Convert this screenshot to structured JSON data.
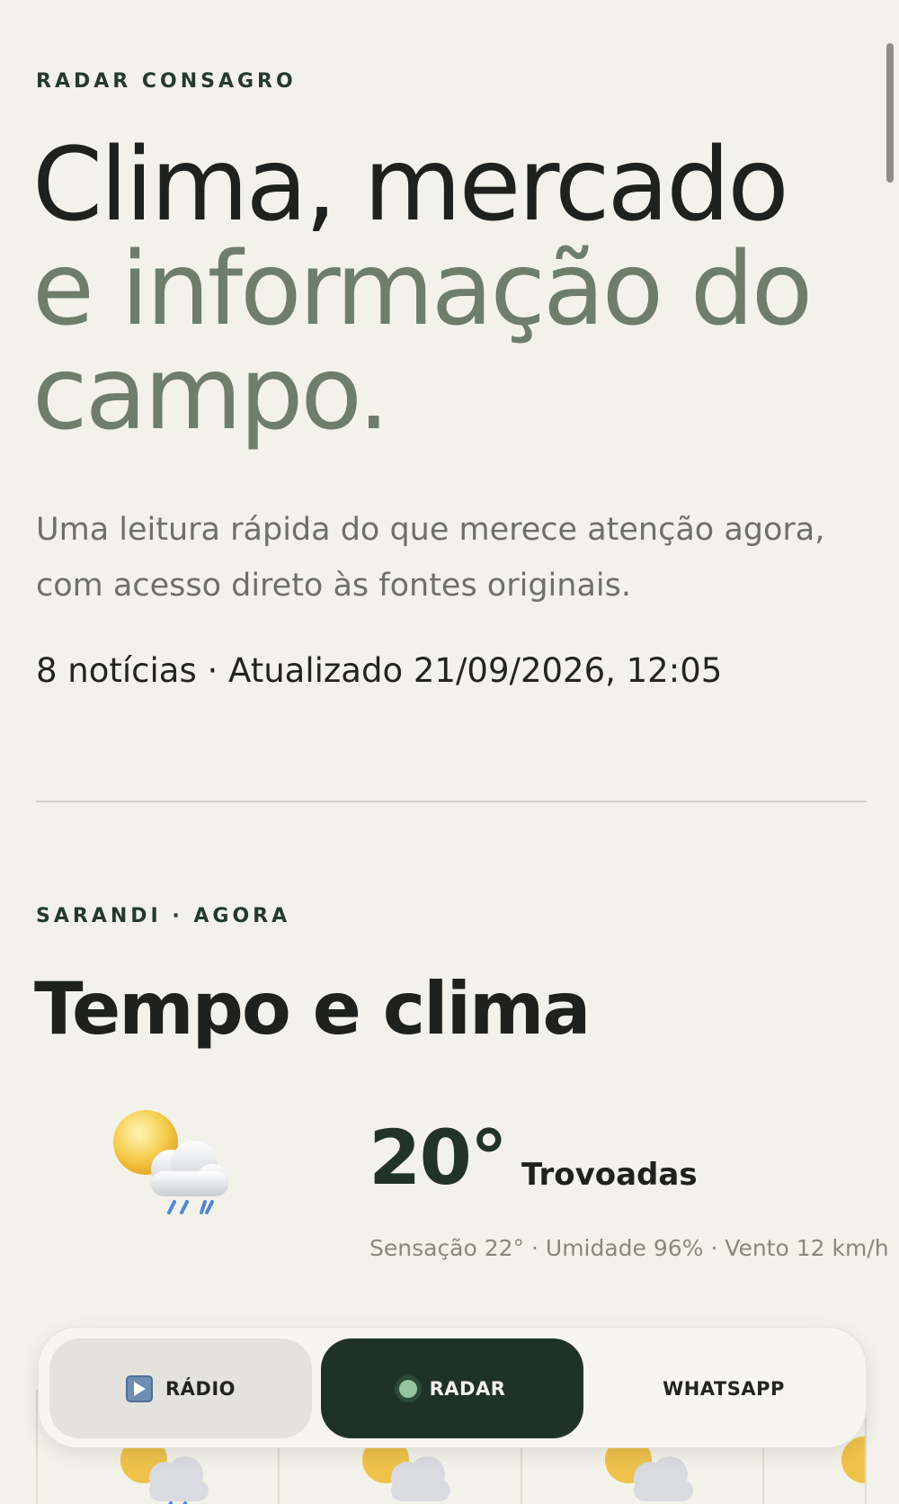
{
  "header": {
    "eyebrow": "RADAR CONSAGRO",
    "title_line1": "Clima, mercado",
    "title_line2": "e informação do",
    "title_line3": "campo.",
    "lead": "Uma leitura rápida do que merece atenção agora, com acesso direto às fontes originais.",
    "meta": "8 notícias · Atualizado 21/09/2026, 12:05"
  },
  "weather": {
    "eyebrow": "SARANDI · AGORA",
    "title": "Tempo e clima",
    "icon": "sun-cloud-thunder-icon",
    "temperature": "20°",
    "condition": "Trovoadas",
    "details": "Sensação 22° · Umidade 96% · Vento 12 km/h",
    "forecast_icons": [
      "sun-cloud-thunder-icon",
      "sun-cloud-icon",
      "sun-cloud-icon",
      "sun-cloud-icon"
    ]
  },
  "nav": {
    "radio_label": "RÁDIO",
    "radar_label": "RADAR",
    "whatsapp_label": "WHATSAPP",
    "active": "radar"
  },
  "colors": {
    "background": "#f3f2ea",
    "accent_dark_green": "#1f3226",
    "muted_green": "#6e7d6c",
    "text": "#1e211c"
  }
}
